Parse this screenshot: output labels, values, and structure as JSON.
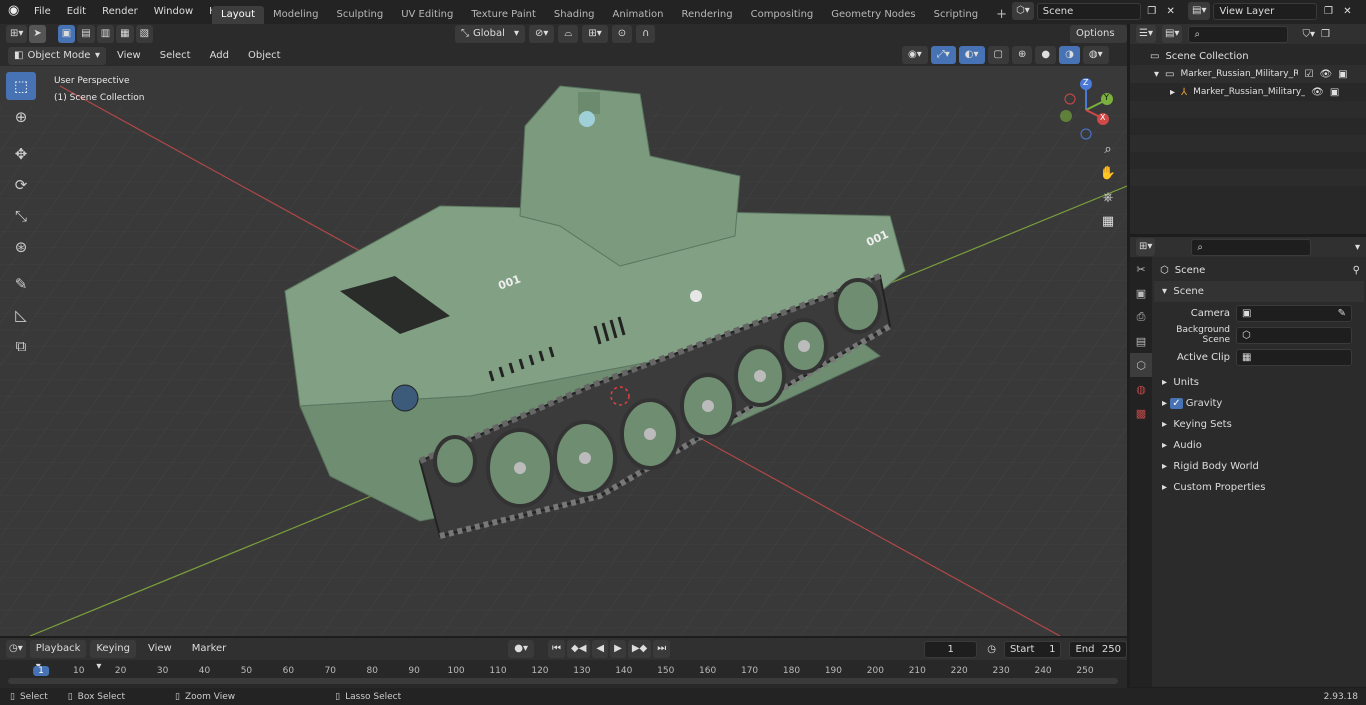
{
  "menu": [
    "File",
    "Edit",
    "Render",
    "Window",
    "Help"
  ],
  "workspaces": [
    "Layout",
    "Modeling",
    "Sculpting",
    "UV Editing",
    "Texture Paint",
    "Shading",
    "Animation",
    "Rendering",
    "Compositing",
    "Geometry Nodes",
    "Scripting"
  ],
  "active_workspace": "Layout",
  "scene_field": "Scene",
  "view_layer_field": "View Layer",
  "viewport_header": {
    "mode": "Object Mode",
    "menus": [
      "View",
      "Select",
      "Add",
      "Object"
    ],
    "transform_orientation": "Global",
    "options_label": "Options"
  },
  "viewport_overlay": {
    "perspective": "User Perspective",
    "collection": "(1) Scene Collection"
  },
  "gizmo": {
    "z": "Z",
    "y": "Y",
    "x": "X"
  },
  "outliner": {
    "root": "Scene Collection",
    "items": [
      {
        "label": "Marker_Russian_Military_Rob"
      },
      {
        "label": "Marker_Russian_Military_"
      }
    ]
  },
  "properties": {
    "context": "Scene",
    "panel": "Scene",
    "rows": [
      {
        "label": "Camera"
      },
      {
        "label": "Background Scene"
      },
      {
        "label": "Active Clip"
      }
    ],
    "subpanels": [
      "Units",
      "Gravity",
      "Keying Sets",
      "Audio",
      "Rigid Body World",
      "Custom Properties"
    ]
  },
  "timeline": {
    "menus": [
      "Playback",
      "Keying",
      "View",
      "Marker"
    ],
    "current_frame": "1",
    "start_label": "Start",
    "start": "1",
    "end_label": "End",
    "end": "250",
    "ruler": [
      "1",
      "10",
      "20",
      "30",
      "40",
      "50",
      "60",
      "70",
      "80",
      "90",
      "100",
      "110",
      "120",
      "130",
      "140",
      "150",
      "160",
      "170",
      "180",
      "190",
      "200",
      "210",
      "220",
      "230",
      "240",
      "250"
    ]
  },
  "statusbar": {
    "items": [
      "Select",
      "Box Select",
      "Zoom View",
      "Lasso Select"
    ],
    "version": "2.93.18"
  },
  "vehicle_labels": [
    "001",
    "001"
  ],
  "colors": {
    "accent": "#4772b3",
    "model": "#7f9c7f",
    "grid": "#454545",
    "x_axis": "#b04848",
    "y_axis": "#7aa03c"
  }
}
